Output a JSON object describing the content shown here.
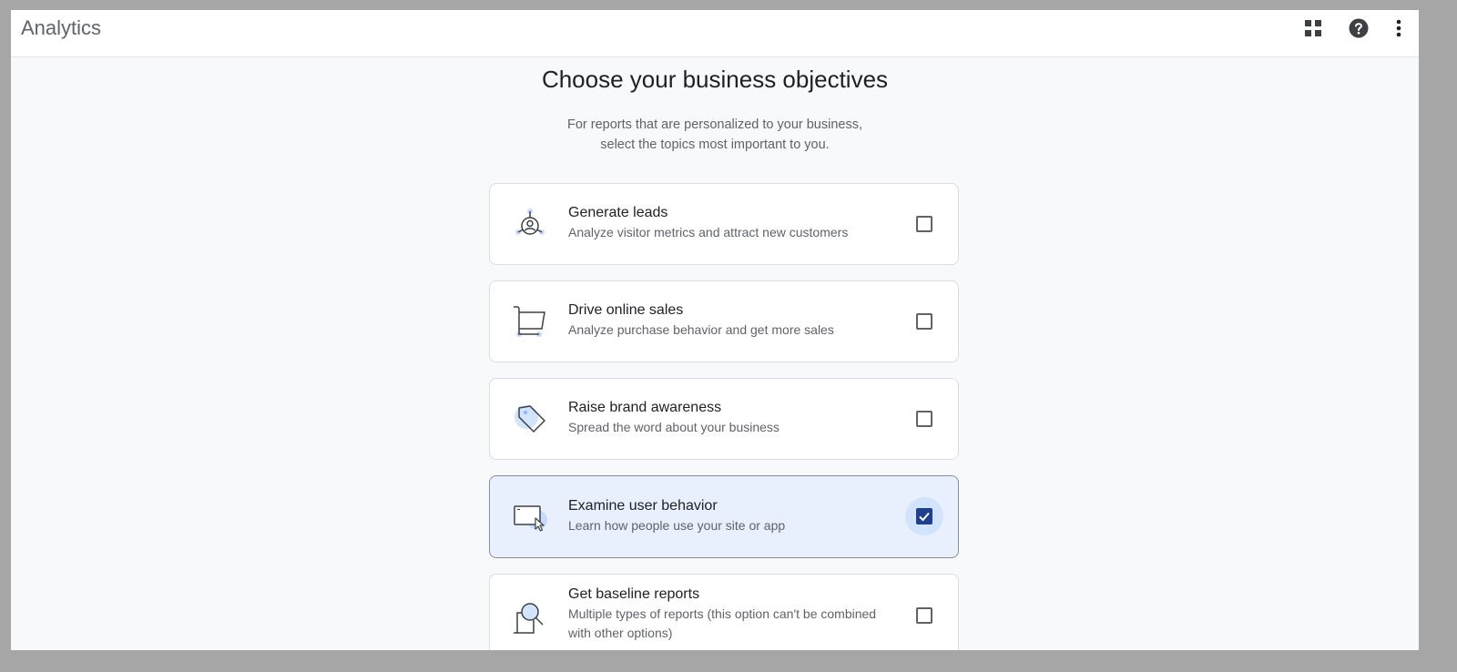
{
  "app": {
    "title": "Analytics",
    "icons": [
      {
        "name": "apps-grid-icon",
        "label": "Apps"
      },
      {
        "name": "help-icon",
        "label": "Help"
      },
      {
        "name": "more-vert-icon",
        "label": "More options"
      }
    ]
  },
  "page": {
    "title": "Choose your business objectives",
    "subtitle_line1": "For reports that are personalized to your business,",
    "subtitle_line2": "select the topics most important to you."
  },
  "objectives": [
    {
      "title": "Generate leads",
      "description": "Analyze visitor metrics and attract new customers",
      "icon": "target-user-icon",
      "checked": false
    },
    {
      "title": "Drive online sales",
      "description": "Analyze purchase behavior and get more sales",
      "icon": "shopping-cart-icon",
      "checked": false
    },
    {
      "title": "Raise brand awareness",
      "description": "Spread the word about your business",
      "icon": "tag-icon",
      "checked": false
    },
    {
      "title": "Examine user behavior",
      "description": "Learn how people use your site or app",
      "icon": "window-cursor-icon",
      "checked": true
    },
    {
      "title": "Get baseline reports",
      "description": "Multiple types of reports (this option can't be combined with other options)",
      "icon": "magnifier-report-icon",
      "checked": false
    }
  ],
  "colors": {
    "selected_bg": "#e8f0fe",
    "checkbox_checked": "#1f3f8f",
    "page_bg": "#f8f9fa"
  }
}
